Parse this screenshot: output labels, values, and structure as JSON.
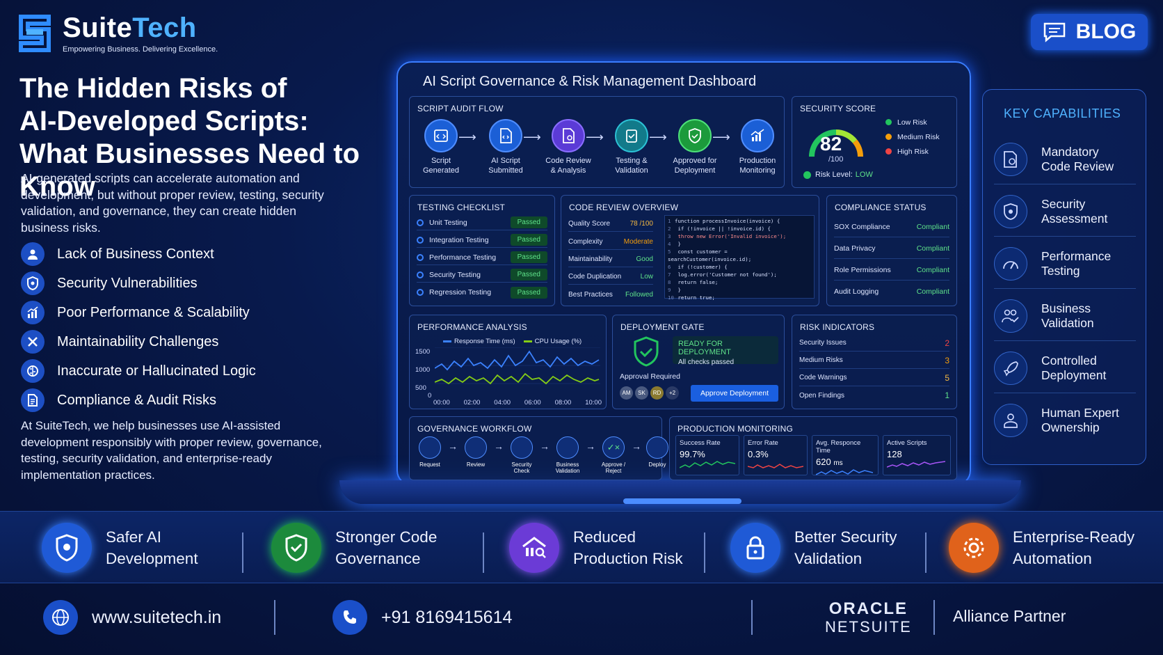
{
  "brand": {
    "name_main": "Suite",
    "name_accent": "Tech",
    "tagline": "Empowering Business. Delivering Excellence."
  },
  "blog_button": {
    "label": "BLOG"
  },
  "headline": [
    "The Hidden Risks of",
    "AI-Developed Scripts:",
    "What Businesses Need to Know"
  ],
  "intro": "AI-generated scripts can accelerate automation and development, but without proper review, testing, security validation, and governance, they can create hidden business risks.",
  "risks": [
    {
      "label": "Lack of Business Context",
      "icon": "user-icon"
    },
    {
      "label": "Security Vulnerabilities",
      "icon": "shield-icon"
    },
    {
      "label": "Poor Performance & Scalability",
      "icon": "bar-chart-icon"
    },
    {
      "label": "Maintainability Challenges",
      "icon": "tools-icon"
    },
    {
      "label": "Inaccurate or Hallucinated Logic",
      "icon": "brain-icon"
    },
    {
      "label": "Compliance & Audit Risks",
      "icon": "document-icon"
    }
  ],
  "outro": "At SuiteTech, we help businesses use AI-assisted development responsibly with proper review, governance, testing, security validation, and enterprise-ready implementation practices.",
  "dashboard": {
    "title": "AI Script Governance & Risk Management Dashboard",
    "audit_flow": {
      "title": "SCRIPT AUDIT FLOW",
      "steps": [
        {
          "l1": "Script",
          "l2": "Generated",
          "color": "#1b5fd6"
        },
        {
          "l1": "AI Script",
          "l2": "Submitted",
          "color": "#1b5fd6"
        },
        {
          "l1": "Code Review",
          "l2": "& Analysis",
          "color": "#5b3bd6"
        },
        {
          "l1": "Testing &",
          "l2": "Validation",
          "color": "#127a8a"
        },
        {
          "l1": "Approved for",
          "l2": "Deployment",
          "color": "#1c9a3c"
        },
        {
          "l1": "Production",
          "l2": "Monitoring",
          "color": "#1b5fd6"
        }
      ]
    },
    "security": {
      "title": "SECURITY SCORE",
      "score": "82",
      "max": "/100",
      "level_label": "Risk Level:",
      "level": "LOW",
      "legend": [
        {
          "label": "Low Risk",
          "color": "#22c55e"
        },
        {
          "label": "Medium Risk",
          "color": "#f59e0b"
        },
        {
          "label": "High Risk",
          "color": "#ef4444"
        }
      ]
    },
    "testing": {
      "title": "TESTING CHECKLIST",
      "items": [
        {
          "name": "Unit Testing",
          "status": "Passed"
        },
        {
          "name": "Integration Testing",
          "status": "Passed"
        },
        {
          "name": "Performance Testing",
          "status": "Passed"
        },
        {
          "name": "Security Testing",
          "status": "Passed"
        },
        {
          "name": "Regression Testing",
          "status": "Passed"
        }
      ]
    },
    "code_review": {
      "title": "CODE REVIEW OVERVIEW",
      "metrics": [
        {
          "name": "Quality Score",
          "value": "78 /100",
          "color": "#f5b942"
        },
        {
          "name": "Complexity",
          "value": "Moderate",
          "color": "#f59e0b"
        },
        {
          "name": "Maintainability",
          "value": "Good",
          "color": "#5fe38a"
        },
        {
          "name": "Code Duplication",
          "value": "Low",
          "color": "#5fe38a"
        },
        {
          "name": "Best Practices",
          "value": "Followed",
          "color": "#5fe38a"
        }
      ],
      "code_lines": [
        "function processInvoice(invoice) {",
        "  if (!invoice || !invoice.id) {",
        "    throw new Error('Invalid invoice');",
        "  }",
        "  const customer = searchCustomer(invoice.id);",
        "  if (!customer) {",
        "    log.error('Customer not found');",
        "    return false;",
        "  }",
        "  return true;"
      ],
      "line_numbers": [
        "1",
        "2",
        "3",
        "4",
        "5",
        "6",
        "7",
        "8",
        "9",
        "10"
      ]
    },
    "compliance": {
      "title": "COMPLIANCE STATUS",
      "items": [
        {
          "name": "SOX Compliance",
          "status": "Compliant"
        },
        {
          "name": "Data Privacy",
          "status": "Compliant"
        },
        {
          "name": "Role Permissions",
          "status": "Compliant"
        },
        {
          "name": "Audit Logging",
          "status": "Compliant"
        }
      ]
    },
    "performance": {
      "title": "PERFORMANCE ANALYSIS",
      "legend": [
        "Response Time (ms)",
        "CPU Usage (%)"
      ],
      "y_ticks": [
        "1500",
        "1000",
        "500",
        "0"
      ],
      "x_ticks": [
        "00:00",
        "02:00",
        "04:00",
        "06:00",
        "08:00",
        "10:00"
      ]
    },
    "deployment": {
      "title": "DEPLOYMENT GATE",
      "status": "READY FOR DEPLOYMENT",
      "sub": "All checks passed",
      "approval_label": "Approval Required",
      "approvers": [
        "AM",
        "SK",
        "RD",
        "+2"
      ],
      "button": "Approve Deployment"
    },
    "risk_indicators": {
      "title": "RISK INDICATORS",
      "items": [
        {
          "name": "Security Issues",
          "value": "2",
          "color": "#ef4444"
        },
        {
          "name": "Medium Risks",
          "value": "3",
          "color": "#f59e0b"
        },
        {
          "name": "Code Warnings",
          "value": "5",
          "color": "#f5b942"
        },
        {
          "name": "Open Findings",
          "value": "1",
          "color": "#5fe38a"
        }
      ]
    },
    "governance": {
      "title": "GOVERNANCE WORKFLOW",
      "steps": [
        "Request",
        "Review",
        "Security Check",
        "Business Validation",
        "Approve / Reject",
        "Deploy"
      ]
    },
    "monitoring": {
      "title": "PRODUCTION MONITORING",
      "cards": [
        {
          "label": "Success Rate",
          "value": "99.7%",
          "color": "#22c55e"
        },
        {
          "label": "Error Rate",
          "value": "0.3%",
          "color": "#ef4444"
        },
        {
          "label": "Avg. Responce Time",
          "value": "620",
          "unit": "ms",
          "color": "#3b82ff"
        },
        {
          "label": "Active Scripts",
          "value": "128",
          "color": "#a855f7"
        }
      ]
    }
  },
  "capabilities": {
    "title": "KEY CAPABILITIES",
    "items": [
      {
        "l1": "Mandatory",
        "l2": "Code Review",
        "icon": "code-review-icon"
      },
      {
        "l1": "Security",
        "l2": "Assessment",
        "icon": "shield-icon"
      },
      {
        "l1": "Performance",
        "l2": "Testing",
        "icon": "gauge-icon"
      },
      {
        "l1": "Business",
        "l2": "Validation",
        "icon": "users-check-icon"
      },
      {
        "l1": "Controlled",
        "l2": "Deployment",
        "icon": "rocket-icon"
      },
      {
        "l1": "Human Expert",
        "l2": "Ownership",
        "icon": "user-expert-icon"
      }
    ]
  },
  "benefits": [
    {
      "l1": "Safer AI",
      "l2": "Development",
      "color": "#1f5ad6"
    },
    {
      "l1": "Stronger Code",
      "l2": "Governance",
      "color": "#1c8a3c"
    },
    {
      "l1": "Reduced",
      "l2": "Production Risk",
      "color": "#6b3bd6"
    },
    {
      "l1": "Better Security",
      "l2": "Validation",
      "color": "#1f5ad6"
    },
    {
      "l1": "Enterprise-Ready",
      "l2": "Automation",
      "color": "#e0621b"
    }
  ],
  "footer": {
    "website": "www.suitetech.in",
    "phone": "+91 8169415614",
    "partner_l1": "ORACLE",
    "partner_l2": "NETSUITE",
    "partner_label": "Alliance Partner"
  }
}
